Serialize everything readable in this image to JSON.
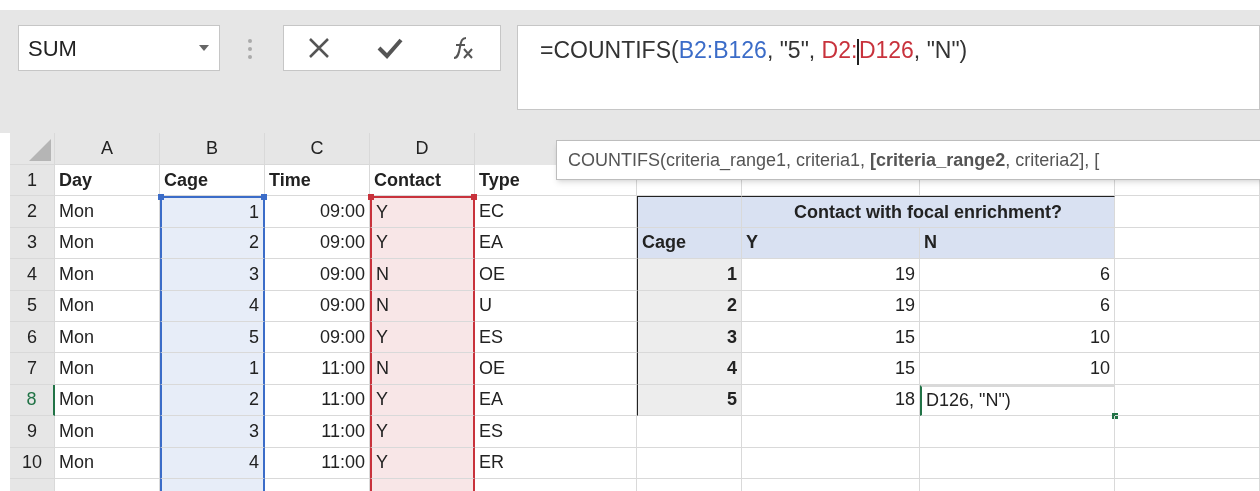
{
  "name_box": {
    "value": "SUM"
  },
  "formula_bar": {
    "segments": [
      {
        "text": "=COUNTIFS(",
        "color": "#333333"
      },
      {
        "text": "B2:B126",
        "color": "#3b6cc8"
      },
      {
        "text": ", \"5\", ",
        "color": "#333333"
      },
      {
        "text": "D2:",
        "color": "#c8323c",
        "caret": true
      },
      {
        "text": "D126",
        "color": "#c8323c"
      },
      {
        "text": ", \"N\")",
        "color": "#333333"
      }
    ]
  },
  "tooltip": {
    "text": "COUNTIFS(criteria_range1, criteria1, **[criteria_range2**, criteria2], ["
  },
  "columns": [
    {
      "label": "A",
      "kind": "text"
    },
    {
      "label": "B",
      "kind": "number",
      "color": "#3b6cc8"
    },
    {
      "label": "C",
      "kind": "number"
    },
    {
      "label": "D",
      "kind": "text",
      "color": "#c8323c"
    },
    {
      "kind": "text"
    }
  ],
  "rows": [
    {
      "number": "1",
      "selected": false,
      "cells": [
        "Day",
        "Cage",
        "Time",
        "Contact",
        "Type"
      ]
    },
    {
      "number": "2",
      "selected": false,
      "cells": [
        "Mon",
        "1",
        "09:00",
        "Y",
        "EC"
      ]
    },
    {
      "number": "3",
      "selected": false,
      "cells": [
        "Mon",
        "2",
        "09:00",
        "Y",
        "EA"
      ]
    },
    {
      "number": "4",
      "selected": false,
      "cells": [
        "Mon",
        "3",
        "09:00",
        "N",
        "OE"
      ]
    },
    {
      "number": "5",
      "selected": false,
      "cells": [
        "Mon",
        "4",
        "09:00",
        "N",
        "U"
      ]
    },
    {
      "number": "6",
      "selected": false,
      "cells": [
        "Mon",
        "5",
        "09:00",
        "Y",
        "ES"
      ]
    },
    {
      "number": "7",
      "selected": false,
      "cells": [
        "Mon",
        "1",
        "11:00",
        "N",
        "OE"
      ]
    },
    {
      "number": "8",
      "selected": true,
      "cells": [
        "Mon",
        "2",
        "11:00",
        "Y",
        "EA"
      ]
    },
    {
      "number": "9",
      "selected": false,
      "cells": [
        "Mon",
        "3",
        "11:00",
        "Y",
        "ES"
      ]
    },
    {
      "number": "10",
      "selected": false,
      "cells": [
        "Mon",
        "4",
        "11:00",
        "Y",
        "ER"
      ]
    }
  ],
  "summary_table": {
    "title": "Contact with focal enrichment?",
    "columns": [
      "Cage",
      "Y",
      "N"
    ],
    "rows": [
      [
        "1",
        "19",
        "6"
      ],
      [
        "2",
        "19",
        "6"
      ],
      [
        "3",
        "15",
        "10"
      ],
      [
        "4",
        "15",
        "10"
      ],
      [
        "5",
        "18"
      ]
    ]
  },
  "active_cell": {
    "edit_text": "D126, \"N\")"
  }
}
